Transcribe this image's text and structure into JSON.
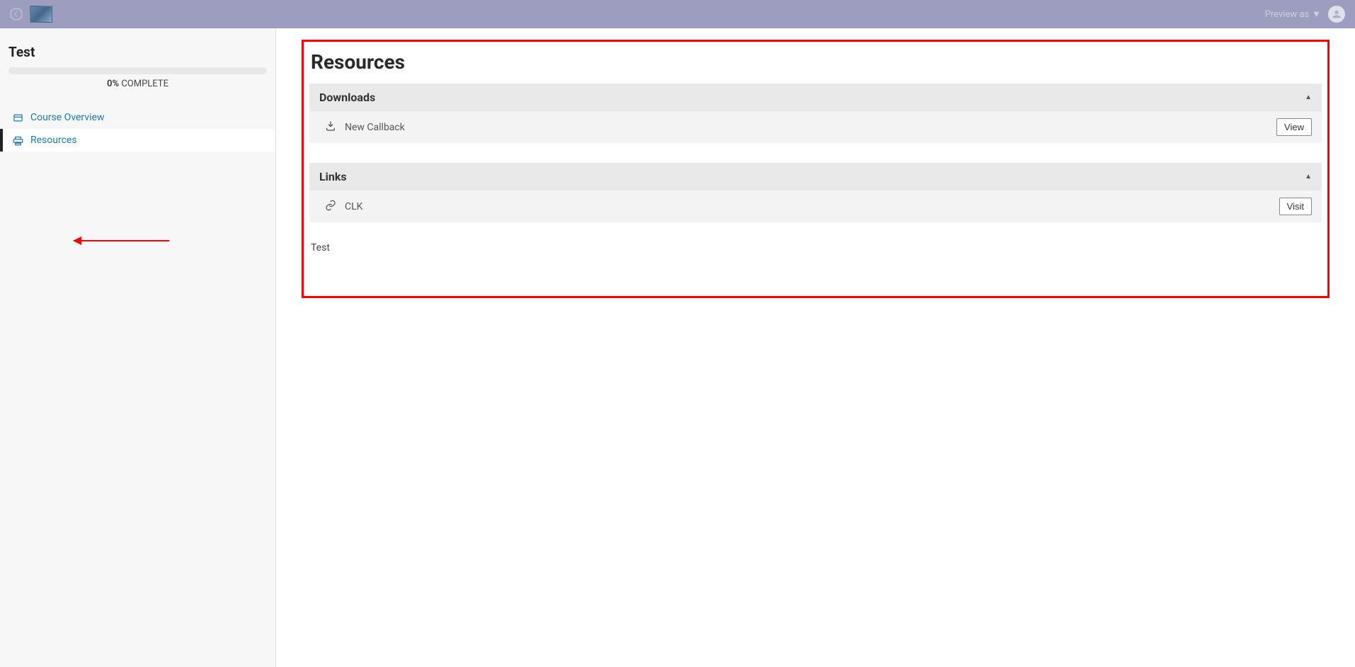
{
  "header": {
    "preview_as_label": "Preview as"
  },
  "sidebar": {
    "course_title": "Test",
    "progress_percent": "0%",
    "progress_suffix": " COMPLETE",
    "nav": [
      {
        "label": "Course Overview",
        "icon": "card"
      },
      {
        "label": "Resources",
        "icon": "print"
      }
    ]
  },
  "main": {
    "page_title": "Resources",
    "sections": [
      {
        "title": "Downloads",
        "item_label": "New Callback",
        "button_label": "View"
      },
      {
        "title": "Links",
        "item_label": "CLK",
        "button_label": "Visit"
      }
    ],
    "text_block": "Test"
  }
}
